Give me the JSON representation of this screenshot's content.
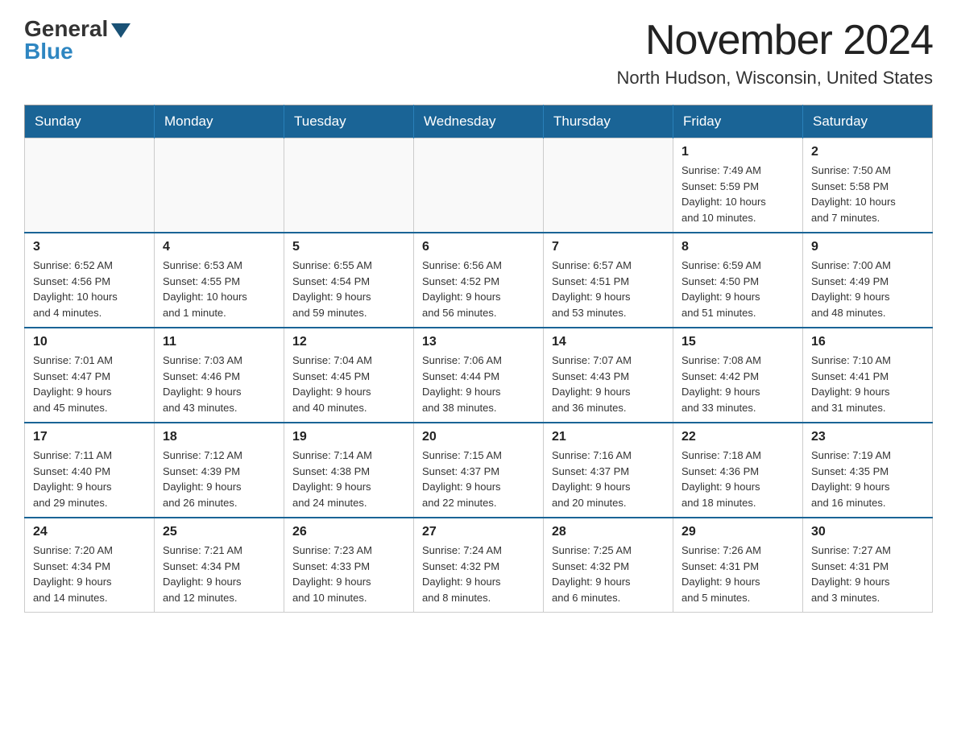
{
  "header": {
    "logo_general": "General",
    "logo_blue": "Blue",
    "month_title": "November 2024",
    "location": "North Hudson, Wisconsin, United States"
  },
  "weekdays": [
    "Sunday",
    "Monday",
    "Tuesday",
    "Wednesday",
    "Thursday",
    "Friday",
    "Saturday"
  ],
  "weeks": [
    [
      {
        "day": "",
        "info": ""
      },
      {
        "day": "",
        "info": ""
      },
      {
        "day": "",
        "info": ""
      },
      {
        "day": "",
        "info": ""
      },
      {
        "day": "",
        "info": ""
      },
      {
        "day": "1",
        "info": "Sunrise: 7:49 AM\nSunset: 5:59 PM\nDaylight: 10 hours\nand 10 minutes."
      },
      {
        "day": "2",
        "info": "Sunrise: 7:50 AM\nSunset: 5:58 PM\nDaylight: 10 hours\nand 7 minutes."
      }
    ],
    [
      {
        "day": "3",
        "info": "Sunrise: 6:52 AM\nSunset: 4:56 PM\nDaylight: 10 hours\nand 4 minutes."
      },
      {
        "day": "4",
        "info": "Sunrise: 6:53 AM\nSunset: 4:55 PM\nDaylight: 10 hours\nand 1 minute."
      },
      {
        "day": "5",
        "info": "Sunrise: 6:55 AM\nSunset: 4:54 PM\nDaylight: 9 hours\nand 59 minutes."
      },
      {
        "day": "6",
        "info": "Sunrise: 6:56 AM\nSunset: 4:52 PM\nDaylight: 9 hours\nand 56 minutes."
      },
      {
        "day": "7",
        "info": "Sunrise: 6:57 AM\nSunset: 4:51 PM\nDaylight: 9 hours\nand 53 minutes."
      },
      {
        "day": "8",
        "info": "Sunrise: 6:59 AM\nSunset: 4:50 PM\nDaylight: 9 hours\nand 51 minutes."
      },
      {
        "day": "9",
        "info": "Sunrise: 7:00 AM\nSunset: 4:49 PM\nDaylight: 9 hours\nand 48 minutes."
      }
    ],
    [
      {
        "day": "10",
        "info": "Sunrise: 7:01 AM\nSunset: 4:47 PM\nDaylight: 9 hours\nand 45 minutes."
      },
      {
        "day": "11",
        "info": "Sunrise: 7:03 AM\nSunset: 4:46 PM\nDaylight: 9 hours\nand 43 minutes."
      },
      {
        "day": "12",
        "info": "Sunrise: 7:04 AM\nSunset: 4:45 PM\nDaylight: 9 hours\nand 40 minutes."
      },
      {
        "day": "13",
        "info": "Sunrise: 7:06 AM\nSunset: 4:44 PM\nDaylight: 9 hours\nand 38 minutes."
      },
      {
        "day": "14",
        "info": "Sunrise: 7:07 AM\nSunset: 4:43 PM\nDaylight: 9 hours\nand 36 minutes."
      },
      {
        "day": "15",
        "info": "Sunrise: 7:08 AM\nSunset: 4:42 PM\nDaylight: 9 hours\nand 33 minutes."
      },
      {
        "day": "16",
        "info": "Sunrise: 7:10 AM\nSunset: 4:41 PM\nDaylight: 9 hours\nand 31 minutes."
      }
    ],
    [
      {
        "day": "17",
        "info": "Sunrise: 7:11 AM\nSunset: 4:40 PM\nDaylight: 9 hours\nand 29 minutes."
      },
      {
        "day": "18",
        "info": "Sunrise: 7:12 AM\nSunset: 4:39 PM\nDaylight: 9 hours\nand 26 minutes."
      },
      {
        "day": "19",
        "info": "Sunrise: 7:14 AM\nSunset: 4:38 PM\nDaylight: 9 hours\nand 24 minutes."
      },
      {
        "day": "20",
        "info": "Sunrise: 7:15 AM\nSunset: 4:37 PM\nDaylight: 9 hours\nand 22 minutes."
      },
      {
        "day": "21",
        "info": "Sunrise: 7:16 AM\nSunset: 4:37 PM\nDaylight: 9 hours\nand 20 minutes."
      },
      {
        "day": "22",
        "info": "Sunrise: 7:18 AM\nSunset: 4:36 PM\nDaylight: 9 hours\nand 18 minutes."
      },
      {
        "day": "23",
        "info": "Sunrise: 7:19 AM\nSunset: 4:35 PM\nDaylight: 9 hours\nand 16 minutes."
      }
    ],
    [
      {
        "day": "24",
        "info": "Sunrise: 7:20 AM\nSunset: 4:34 PM\nDaylight: 9 hours\nand 14 minutes."
      },
      {
        "day": "25",
        "info": "Sunrise: 7:21 AM\nSunset: 4:34 PM\nDaylight: 9 hours\nand 12 minutes."
      },
      {
        "day": "26",
        "info": "Sunrise: 7:23 AM\nSunset: 4:33 PM\nDaylight: 9 hours\nand 10 minutes."
      },
      {
        "day": "27",
        "info": "Sunrise: 7:24 AM\nSunset: 4:32 PM\nDaylight: 9 hours\nand 8 minutes."
      },
      {
        "day": "28",
        "info": "Sunrise: 7:25 AM\nSunset: 4:32 PM\nDaylight: 9 hours\nand 6 minutes."
      },
      {
        "day": "29",
        "info": "Sunrise: 7:26 AM\nSunset: 4:31 PM\nDaylight: 9 hours\nand 5 minutes."
      },
      {
        "day": "30",
        "info": "Sunrise: 7:27 AM\nSunset: 4:31 PM\nDaylight: 9 hours\nand 3 minutes."
      }
    ]
  ]
}
